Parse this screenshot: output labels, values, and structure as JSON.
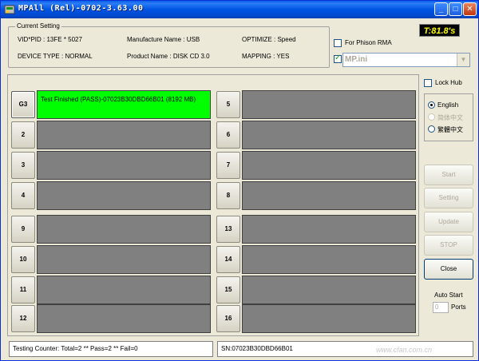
{
  "window": {
    "title": "MPAll (Rel)-0702-3.63.00"
  },
  "current_setting": {
    "legend": "Current Setting",
    "vid_pid_label": "VID*PID :",
    "vid_pid_value": "13FE * 5027",
    "manufacture_label": "Manufacture Name :",
    "manufacture_value": "USB",
    "optimize_label": "OPTIMIZE :",
    "optimize_value": "Speed",
    "device_type_label": "DEVICE TYPE :",
    "device_type_value": "NORMAL",
    "product_label": "Product Name :",
    "product_value": "DISK CD 3.0",
    "mapping_label": "MAPPING :",
    "mapping_value": "YES"
  },
  "timer": "T:81.8's",
  "for_phison_rma": {
    "label": "For Phison RMA",
    "checked": false
  },
  "ini": {
    "checked": true,
    "value": "MP.ini"
  },
  "lock_hub": {
    "label": "Lock Hub",
    "checked": false
  },
  "language": {
    "options": [
      {
        "label": "English",
        "selected": true,
        "enabled": true
      },
      {
        "label": "简体中文",
        "selected": false,
        "enabled": false
      },
      {
        "label": "繁體中文",
        "selected": false,
        "enabled": true
      }
    ]
  },
  "ports": [
    {
      "label": "G3",
      "status": "Test Finished (PASS)-07023B30DBD66B01 (8192 MB)",
      "state": "pass"
    },
    {
      "label": "2",
      "status": "",
      "state": "idle"
    },
    {
      "label": "3",
      "status": "",
      "state": "idle"
    },
    {
      "label": "4",
      "status": "",
      "state": "idle"
    },
    {
      "label": "5",
      "status": "",
      "state": "idle"
    },
    {
      "label": "6",
      "status": "",
      "state": "idle"
    },
    {
      "label": "7",
      "status": "",
      "state": "idle"
    },
    {
      "label": "8",
      "status": "",
      "state": "idle"
    },
    {
      "label": "9",
      "status": "",
      "state": "idle"
    },
    {
      "label": "10",
      "status": "",
      "state": "idle"
    },
    {
      "label": "11",
      "status": "",
      "state": "idle"
    },
    {
      "label": "12",
      "status": "",
      "state": "idle"
    },
    {
      "label": "13",
      "status": "",
      "state": "idle"
    },
    {
      "label": "14",
      "status": "",
      "state": "idle"
    },
    {
      "label": "15",
      "status": "",
      "state": "idle"
    },
    {
      "label": "16",
      "status": "",
      "state": "idle"
    }
  ],
  "actions": {
    "start": "Start",
    "setting": "Setting",
    "update": "Update",
    "stop": "STOP",
    "close": "Close"
  },
  "auto_start": {
    "label": "Auto Start",
    "ports_value": "0",
    "ports_label": "Ports"
  },
  "status": {
    "counter": "Testing Counter: Total=2 ** Pass=2 ** Fail=0",
    "sn": "SN:07023B30DBD66B01"
  },
  "watermark": "www.cfan.com.cn"
}
